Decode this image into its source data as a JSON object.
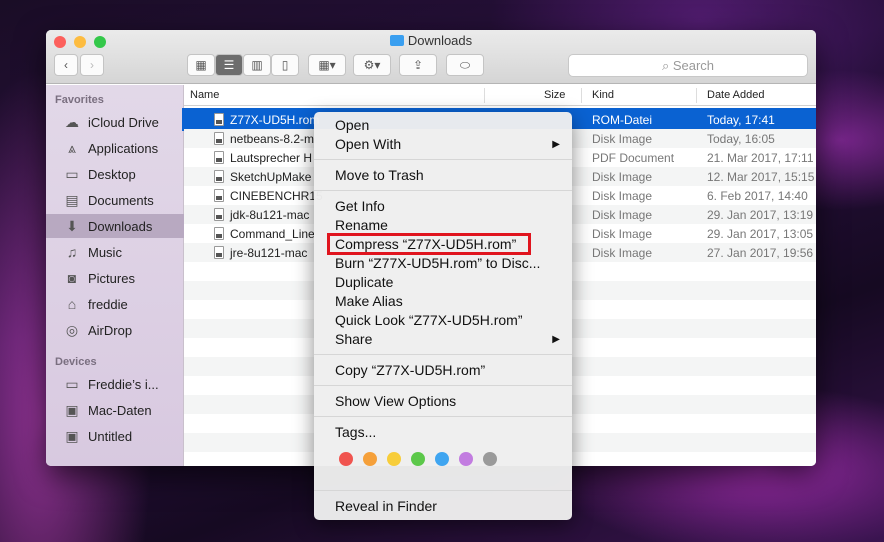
{
  "window": {
    "title": "Downloads",
    "search_placeholder": "Search"
  },
  "sidebar": {
    "favorites_label": "Favorites",
    "devices_label": "Devices",
    "favorites": [
      {
        "label": "iCloud Drive",
        "icon": "cloud-icon"
      },
      {
        "label": "Applications",
        "icon": "applications-icon"
      },
      {
        "label": "Desktop",
        "icon": "desktop-icon"
      },
      {
        "label": "Documents",
        "icon": "documents-icon"
      },
      {
        "label": "Downloads",
        "icon": "downloads-icon"
      },
      {
        "label": "Music",
        "icon": "music-icon"
      },
      {
        "label": "Pictures",
        "icon": "pictures-icon"
      },
      {
        "label": "freddie",
        "icon": "home-icon"
      },
      {
        "label": "AirDrop",
        "icon": "airdrop-icon"
      }
    ],
    "devices": [
      {
        "label": "Freddie’s i...",
        "icon": "computer-icon"
      },
      {
        "label": "Mac-Daten",
        "icon": "disk-icon"
      },
      {
        "label": "Untitled",
        "icon": "disk-icon"
      }
    ]
  },
  "columns": {
    "name": "Name",
    "size": "Size",
    "kind": "Kind",
    "date": "Date Added"
  },
  "files": [
    {
      "name": "Z77X-UD5H.rom",
      "kind": "ROM-Datei",
      "date": "Today, 17:41"
    },
    {
      "name": "netbeans-8.2-m",
      "kind": "Disk Image",
      "date": "Today, 16:05"
    },
    {
      "name": "Lautsprecher H",
      "kind": "PDF Document",
      "date": "21. Mar 2017, 17:11"
    },
    {
      "name": "SketchUpMake",
      "kind": "Disk Image",
      "date": "12. Mar 2017, 15:15"
    },
    {
      "name": "CINEBENCHR15",
      "kind": "Disk Image",
      "date": "6. Feb 2017, 14:40"
    },
    {
      "name": "jdk-8u121-mac",
      "kind": "Disk Image",
      "date": "29. Jan 2017, 13:19"
    },
    {
      "name": "Command_Line",
      "kind": "Disk Image",
      "date": "29. Jan 2017, 13:05"
    },
    {
      "name": "jre-8u121-mac",
      "kind": "Disk Image",
      "date": "27. Jan 2017, 19:56"
    }
  ],
  "menu": {
    "groups": [
      [
        "Open",
        "Open With"
      ],
      [
        "Move to Trash"
      ],
      [
        "Get Info",
        "Rename",
        "Compress “Z77X-UD5H.rom”",
        "Burn “Z77X-UD5H.rom” to Disc...",
        "Duplicate",
        "Make Alias",
        "Quick Look “Z77X-UD5H.rom”",
        "Share"
      ],
      [
        "Copy “Z77X-UD5H.rom”"
      ],
      [
        "Show View Options"
      ],
      [
        "Tags..."
      ]
    ],
    "reveal": "Reveal in Finder",
    "tag_colors": [
      "#f0544f",
      "#f5a03a",
      "#f7cd3a",
      "#5cc84a",
      "#3fa5f0",
      "#c27ce0",
      "#9a9a9a"
    ]
  }
}
